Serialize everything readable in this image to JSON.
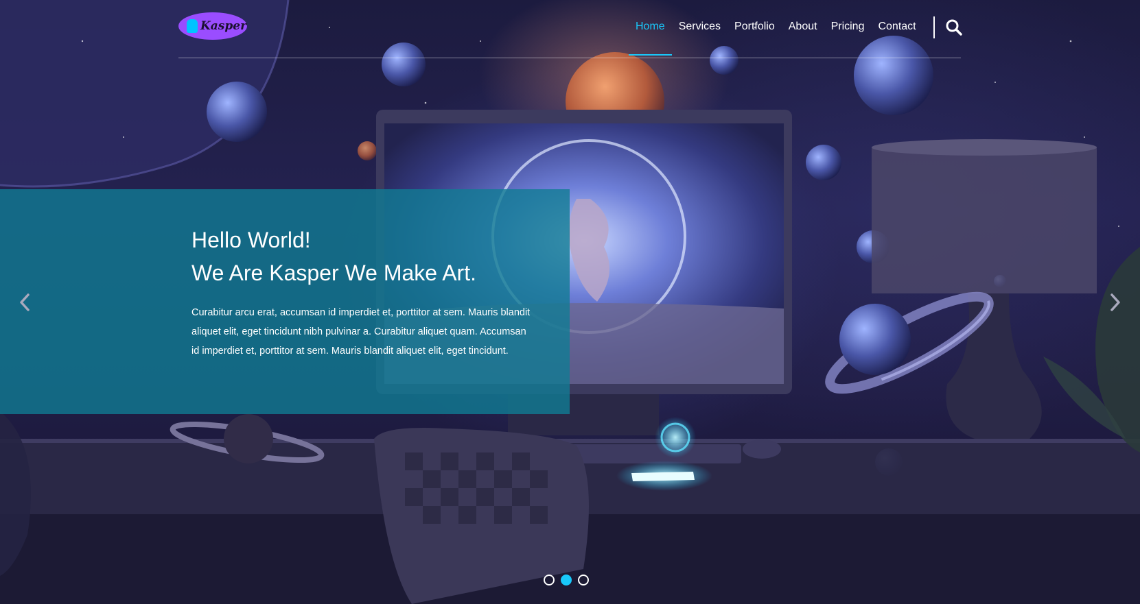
{
  "brand": {
    "logo_text": "Kasper",
    "accent_color": "#19c8fa",
    "logo_bg_color": "#9a4dff"
  },
  "nav": {
    "items": [
      {
        "label": "Home",
        "active": true
      },
      {
        "label": "Services",
        "active": false
      },
      {
        "label": "Portfolio",
        "active": false
      },
      {
        "label": "About",
        "active": false
      },
      {
        "label": "Pricing",
        "active": false
      },
      {
        "label": "Contact",
        "active": false
      }
    ],
    "search_icon": "search-icon"
  },
  "hero": {
    "title_line1": "Hello World!",
    "title_line2": "We Are Kasper We Make Art.",
    "text": "Curabitur arcu erat, accumsan id imperdiet et, porttitor at sem. Mauris blandit aliquet elit, eget tincidunt nibh pulvinar a. Curabitur aliquet quam. Accumsan id imperdiet et, porttitor at sem. Mauris blandit aliquet elit, eget tincidunt.",
    "panel_color": "#107c94"
  },
  "carousel": {
    "prev_icon": "chevron-left-icon",
    "next_icon": "chevron-right-icon",
    "slide_count": 3,
    "active_slide": 2
  }
}
